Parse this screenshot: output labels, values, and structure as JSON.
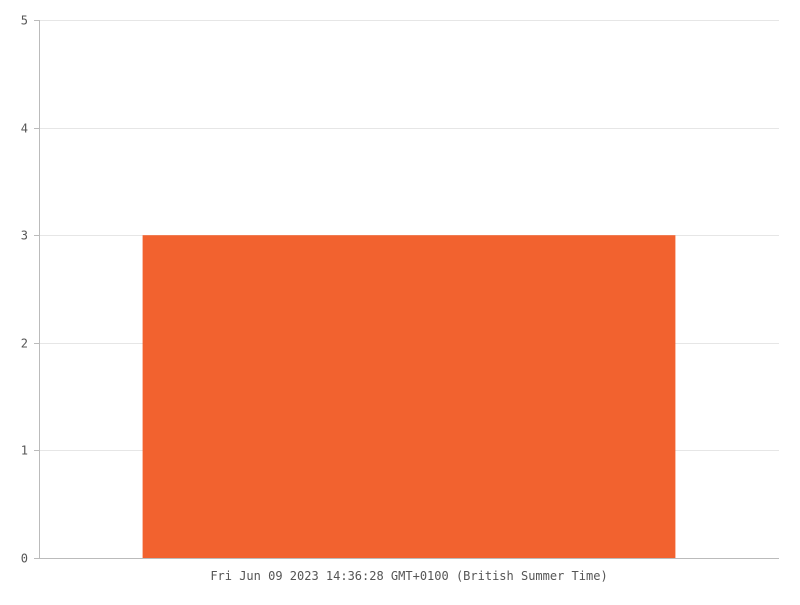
{
  "chart_data": {
    "type": "bar",
    "title": "",
    "xlabel": "",
    "ylabel": "",
    "categories": [
      "Fri Jun 09 2023 14:36:28 GMT+0100 (British Summer Time)"
    ],
    "values": [
      3
    ],
    "ylim": [
      0,
      5
    ],
    "yticks": [
      0,
      1,
      2,
      3,
      4,
      5
    ],
    "ytick_labels": [
      "0",
      "1",
      "2",
      "3",
      "4",
      "5"
    ],
    "grid": true,
    "legend": "none",
    "colors": {
      "bar": "#f2622f",
      "grid": "#e6e6e6",
      "axis": "#bbbbbb",
      "text": "#555555"
    }
  }
}
